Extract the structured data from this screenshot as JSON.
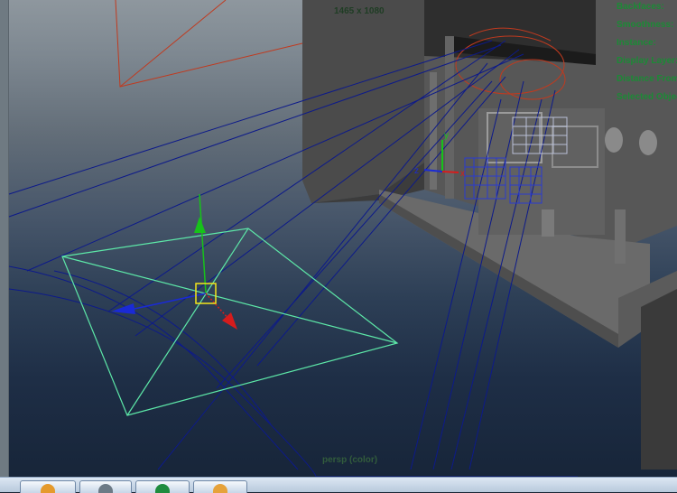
{
  "viewport": {
    "resolution_label": "1465 x 1080",
    "camera_label": "persp (color)"
  },
  "hud": {
    "lines": [
      "Backfaces:",
      "Smoothness:",
      "Instance:",
      "Display Layer:",
      "Distance From Camera:",
      "Selected Objects:"
    ]
  },
  "gizmo": {
    "axis_y_label": "y",
    "axis_z_label": "z",
    "axis_x_label": "x"
  },
  "colors": {
    "move_y": "#17c21a",
    "move_x": "#d61c1c",
    "move_z": "#1a2ad6",
    "camera_frustum": "#5de8a8",
    "hud_text": "#1c8a36",
    "selection_curves": "#0d1a8a"
  },
  "taskbar": {
    "buttons": [
      {
        "icon": "folder-icon"
      },
      {
        "icon": "terminal-icon"
      },
      {
        "icon": "browser-icon"
      },
      {
        "icon": "media-icon"
      }
    ]
  }
}
